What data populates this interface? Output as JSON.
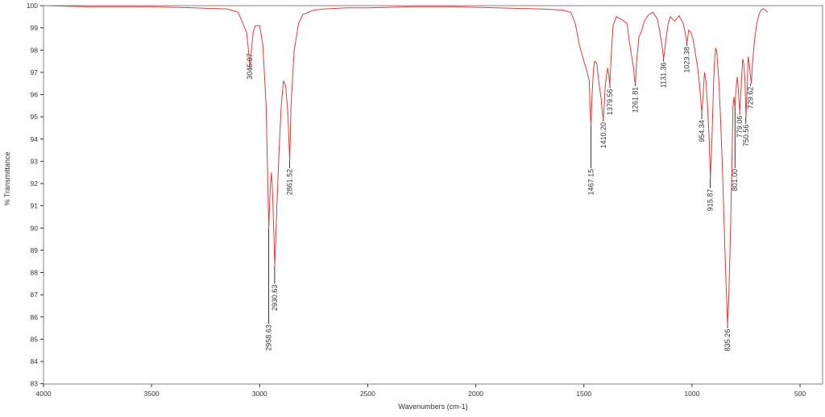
{
  "chart_data": {
    "type": "line",
    "xlabel": "Wavenumbers (cm-1)",
    "ylabel": "% Transmittance",
    "xlim": [
      4000,
      450
    ],
    "ylim": [
      83,
      100
    ],
    "x_reversed": true,
    "xticks": [
      4000,
      3500,
      3000,
      2500,
      2000,
      1500,
      1000,
      500
    ],
    "yticks": [
      83,
      84,
      85,
      86,
      87,
      88,
      89,
      90,
      91,
      92,
      93,
      94,
      95,
      96,
      97,
      98,
      99,
      100
    ],
    "grid": false,
    "colors": {
      "series": "#e03a3a",
      "frame": "#808080",
      "leader": "#000000"
    },
    "series": [
      {
        "x": [
          4000,
          3800,
          3500,
          3300,
          3150,
          3100,
          3060,
          3045,
          3030,
          3020,
          3000,
          2985,
          2970,
          2965,
          2958,
          2950,
          2945,
          2940,
          2930,
          2920,
          2910,
          2900,
          2890,
          2880,
          2870,
          2861,
          2855,
          2840,
          2820,
          2800,
          2750,
          2700,
          2600,
          2500,
          2300,
          2100,
          1900,
          1700,
          1600,
          1560,
          1540,
          1520,
          1500,
          1490,
          1480,
          1475,
          1470,
          1467,
          1462,
          1455,
          1450,
          1440,
          1430,
          1420,
          1415,
          1410,
          1400,
          1390,
          1385,
          1380,
          1375,
          1365,
          1350,
          1330,
          1300,
          1290,
          1280,
          1270,
          1265,
          1261,
          1255,
          1245,
          1235,
          1220,
          1200,
          1180,
          1160,
          1150,
          1140,
          1131,
          1120,
          1110,
          1100,
          1080,
          1060,
          1040,
          1030,
          1023,
          1015,
          1005,
          995,
          985,
          975,
          965,
          958,
          954,
          948,
          942,
          935,
          928,
          920,
          915,
          908,
          900,
          895,
          890,
          885,
          880,
          875,
          870,
          860,
          850,
          842,
          838,
          835,
          830,
          825,
          820,
          815,
          810,
          805,
          801,
          795,
          790,
          785,
          779,
          775,
          770,
          765,
          760,
          755,
          750,
          745,
          740,
          735,
          729,
          725,
          720,
          710,
          700,
          690,
          680,
          670,
          660,
          650
        ],
        "y": [
          100,
          99.95,
          99.95,
          99.9,
          99.85,
          99.7,
          98.8,
          97.3,
          98.8,
          99.1,
          99.1,
          98.2,
          95.5,
          93.2,
          90.0,
          92.0,
          92.5,
          91.5,
          88.3,
          91.0,
          93.5,
          95.5,
          96.6,
          96.4,
          95.2,
          93.0,
          95.5,
          98.0,
          99.2,
          99.6,
          99.8,
          99.85,
          99.9,
          99.9,
          99.95,
          99.95,
          99.9,
          99.85,
          99.8,
          99.7,
          99.2,
          98.2,
          97.5,
          97.2,
          96.8,
          96.6,
          95.0,
          94.6,
          96.0,
          97.2,
          97.5,
          97.4,
          96.5,
          95.8,
          95.2,
          94.9,
          96.5,
          97.2,
          96.9,
          96.4,
          97.5,
          99.1,
          99.5,
          99.4,
          99.2,
          98.4,
          97.8,
          97.2,
          96.6,
          96.5,
          97.6,
          98.6,
          98.8,
          99.3,
          99.6,
          99.7,
          99.4,
          98.9,
          98.3,
          97.6,
          98.5,
          99.2,
          99.5,
          99.3,
          99.55,
          99.2,
          98.7,
          98.3,
          98.9,
          98.8,
          98.5,
          97.9,
          97.3,
          96.5,
          95.6,
          95.2,
          96.0,
          97.0,
          96.6,
          95.5,
          94.0,
          92.2,
          93.8,
          96.5,
          97.6,
          98.1,
          97.9,
          97.2,
          96.5,
          95.5,
          93.0,
          89.8,
          87.5,
          86.5,
          85.6,
          86.8,
          88.5,
          90.5,
          93.0,
          95.5,
          95.9,
          95.4,
          96.4,
          96.8,
          96.2,
          95.2,
          95.8,
          96.8,
          97.6,
          97.4,
          96.7,
          95.0,
          96.2,
          97.7,
          97.4,
          96.8,
          96.5,
          97.4,
          98.5,
          99.2,
          99.6,
          99.8,
          99.85,
          99.8,
          99.7
        ]
      }
    ],
    "peaks": [
      {
        "label": "3045.07",
        "x": 3045.07,
        "y": 97.3,
        "label_y": 98.0
      },
      {
        "label": "2958.63",
        "x": 2958.63,
        "y": 90.0,
        "label_y": 85.8
      },
      {
        "label": "2930.63",
        "x": 2930.63,
        "y": 88.3,
        "label_y": 87.6
      },
      {
        "label": "2861.52",
        "x": 2861.52,
        "y": 93.0,
        "label_y": 92.8
      },
      {
        "label": "1467.15",
        "x": 1467.15,
        "y": 94.6,
        "label_y": 92.8
      },
      {
        "label": "1410.20",
        "x": 1410.2,
        "y": 94.9,
        "label_y": 94.9
      },
      {
        "label": "1379.56",
        "x": 1379.56,
        "y": 96.4,
        "label_y": 96.4
      },
      {
        "label": "1261.81",
        "x": 1261.81,
        "y": 96.5,
        "label_y": 96.5
      },
      {
        "label": "1131.36",
        "x": 1131.36,
        "y": 97.6,
        "label_y": 97.6
      },
      {
        "label": "1023.38",
        "x": 1023.38,
        "y": 98.3,
        "label_y": 98.3
      },
      {
        "label": "954.34",
        "x": 954.34,
        "y": 95.2,
        "label_y": 95.0
      },
      {
        "label": "915.87",
        "x": 915.87,
        "y": 92.2,
        "label_y": 91.9
      },
      {
        "label": "835.26",
        "x": 835.26,
        "y": 85.6,
        "label_y": 85.6
      },
      {
        "label": "801.00",
        "x": 801.0,
        "y": 95.5,
        "label_y": 92.8
      },
      {
        "label": "779.06",
        "x": 779.06,
        "y": 95.2,
        "label_y": 95.2
      },
      {
        "label": "750.56",
        "x": 750.56,
        "y": 95.0,
        "label_y": 94.8
      },
      {
        "label": "729.62",
        "x": 729.62,
        "y": 96.5,
        "label_y": 96.5
      }
    ]
  }
}
